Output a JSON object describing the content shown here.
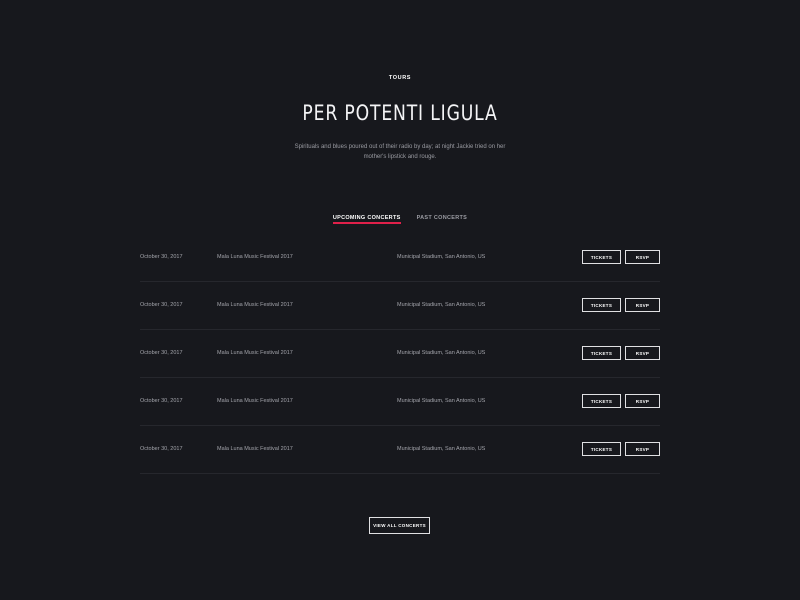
{
  "header": {
    "eyebrow": "TOURS",
    "title": "PER POTENTI LIGULA",
    "subtitle": "Spirituals and blues poured out of their radio by day; at night Jackie tried on her mother's lipstick and rouge."
  },
  "tabs": [
    {
      "label": "UPCOMING CONCERTS",
      "active": true
    },
    {
      "label": "PAST CONCERTS",
      "active": false
    }
  ],
  "colors": {
    "background": "#17181d",
    "accent": "#e0204a"
  },
  "concerts": [
    {
      "date": "October 30, 2017",
      "event": "Mala Luna Music Festival 2017",
      "venue": "Municipal Stadium, San Antonio, US",
      "tickets_label": "TICKETS",
      "rsvp_label": "RSVP"
    },
    {
      "date": "October 30, 2017",
      "event": "Mala Luna Music Festival 2017",
      "venue": "Municipal Stadium, San Antonio, US",
      "tickets_label": "TICKETS",
      "rsvp_label": "RSVP"
    },
    {
      "date": "October 30, 2017",
      "event": "Mala Luna Music Festival 2017",
      "venue": "Municipal Stadium, San Antonio, US",
      "tickets_label": "TICKETS",
      "rsvp_label": "RSVP"
    },
    {
      "date": "October 30, 2017",
      "event": "Mala Luna Music Festival 2017",
      "venue": "Municipal Stadium, San Antonio, US",
      "tickets_label": "TICKETS",
      "rsvp_label": "RSVP"
    },
    {
      "date": "October 30, 2017",
      "event": "Mala Luna Music Festival 2017",
      "venue": "Municipal Stadium, San Antonio, US",
      "tickets_label": "TICKETS",
      "rsvp_label": "RSVP"
    }
  ],
  "footer": {
    "view_all_label": "VIEW ALL CONCERTS"
  }
}
